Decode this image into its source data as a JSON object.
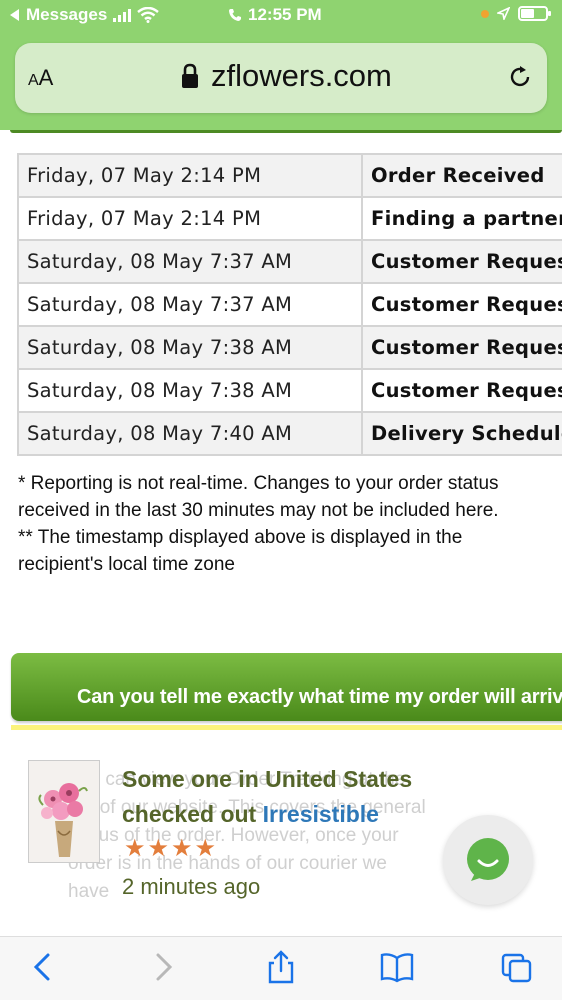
{
  "status_bar": {
    "back_app": "Messages",
    "time": "12:55 PM",
    "battery_level": 0.55
  },
  "browser": {
    "reader_label_big": "A",
    "reader_label_small": "A",
    "domain": "zflowers.com"
  },
  "order_history": [
    {
      "date": "Friday, 07 May 2:14 PM",
      "status": "Order Received"
    },
    {
      "date": "Friday, 07 May 2:14 PM",
      "status": "Finding a partner"
    },
    {
      "date": "Saturday, 08 May 7:37 AM",
      "status": "Customer Request"
    },
    {
      "date": "Saturday, 08 May 7:37 AM",
      "status": "Customer Request"
    },
    {
      "date": "Saturday, 08 May 7:38 AM",
      "status": "Customer Request"
    },
    {
      "date": "Saturday, 08 May 7:38 AM",
      "status": "Customer Request"
    },
    {
      "date": "Saturday, 08 May 7:40 AM",
      "status": "Delivery Scheduled"
    }
  ],
  "notes": {
    "line1": "* Reporting is not real-time. Changes to your order status received in the last 30 minutes may not be included here.",
    "line2": "** The timestamp displayed above is displayed in the recipient's local time zone"
  },
  "faq": {
    "question": "Can you tell me exactly what time my order will arrive?",
    "answer_preview": "You can view your Order Tracking at the top of our website. This covers the general status of the order. However, once your order is in the hands of our courier we have"
  },
  "popup": {
    "who": "Some one in United States",
    "action": "checked out ",
    "product": "Irresistible",
    "rating": 4,
    "stars": "★★★★",
    "time_ago": "2 minutes ago"
  },
  "colors": {
    "browser_bar": "#8fd370",
    "header_green": "#4a8a1a",
    "popup_text": "#55652a",
    "product_link": "#2e78b8",
    "stars": "#e37e3c",
    "chat_green": "#5fb44a",
    "ios_blue": "#1a73e8"
  },
  "icons": [
    "back-chevron-icon",
    "signal-icon",
    "wifi-icon",
    "phone-icon",
    "location-icon",
    "battery-icon",
    "lock-icon",
    "reload-icon",
    "chat-icon",
    "share-icon",
    "bookmarks-icon",
    "tabs-icon",
    "forward-chevron-icon"
  ]
}
